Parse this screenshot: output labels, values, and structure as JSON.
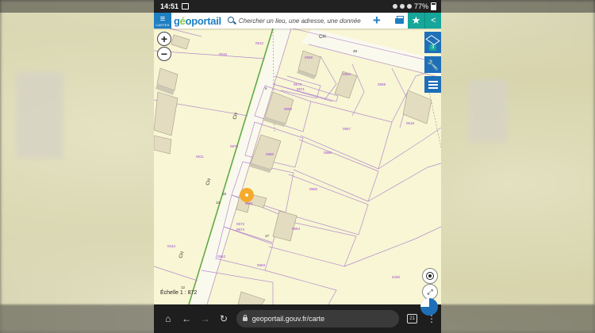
{
  "status_bar": {
    "time": "14:51",
    "battery": "77%"
  },
  "header": {
    "menu_label": "CARTES",
    "logo_g": "g",
    "logo_o": "é",
    "logo_rest": "oportail",
    "search_placeholder": "Chercher un lieu, une adresse, une donnée",
    "add_label": "+"
  },
  "layers": {
    "count": "3"
  },
  "map": {
    "scale_text": "Échelle 1 : 872",
    "road_labels": [
      "CH",
      "CH",
      "CH",
      "CH"
    ],
    "parcel_labels": [
      "0510",
      "0512",
      "0558",
      "0564",
      "0569",
      "0573",
      "0571",
      "0559",
      "0567",
      "0518",
      "0575",
      "0560",
      "0566",
      "0511",
      "0565",
      "0561",
      "0573",
      "0574",
      "0564",
      "0562",
      "0563",
      "0444",
      "0430"
    ],
    "street_numbers": [
      "48",
      "5",
      "15",
      "13",
      "17",
      "12"
    ],
    "selected_point_color": "#f5a623"
  },
  "browser": {
    "url": "geoportail.gouv.fr/carte",
    "tab_count": "21"
  }
}
